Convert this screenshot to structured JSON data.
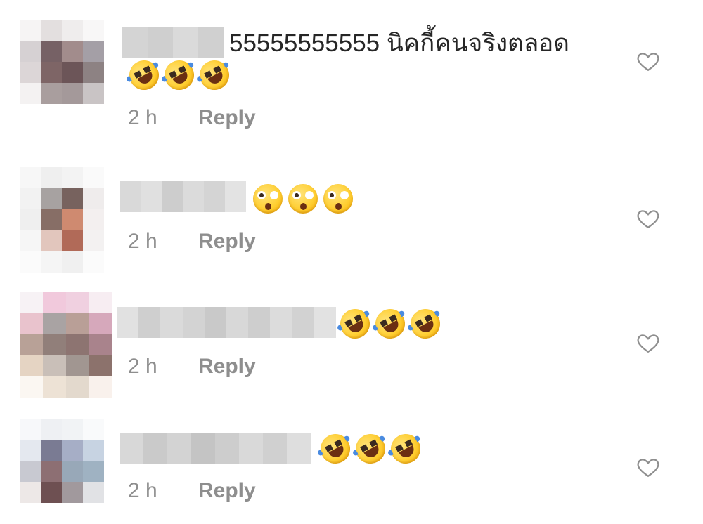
{
  "comments": [
    {
      "text": "55555555555 นิคกี้คนจริงตลอด",
      "emojis": [
        "rofl",
        "rofl",
        "rofl"
      ],
      "time": "2 h",
      "reply_label": "Reply"
    },
    {
      "text": "",
      "emojis": [
        "flushed",
        "flushed",
        "flushed"
      ],
      "time": "2 h",
      "reply_label": "Reply"
    },
    {
      "text": "",
      "emojis": [
        "rofl",
        "rofl",
        "rofl"
      ],
      "time": "2 h",
      "reply_label": "Reply"
    },
    {
      "text": "",
      "emojis": [
        "rofl",
        "rofl",
        "rofl"
      ],
      "time": "2 h",
      "reply_label": "Reply"
    }
  ],
  "icons": {
    "like": "heart-outline-icon",
    "emoji_rofl": "rolling-on-floor-laughing-icon",
    "emoji_flushed": "flushed-face-icon"
  },
  "colors": {
    "text": "#262626",
    "meta": "#8e8e8e",
    "heart": "#8e8e8e"
  }
}
